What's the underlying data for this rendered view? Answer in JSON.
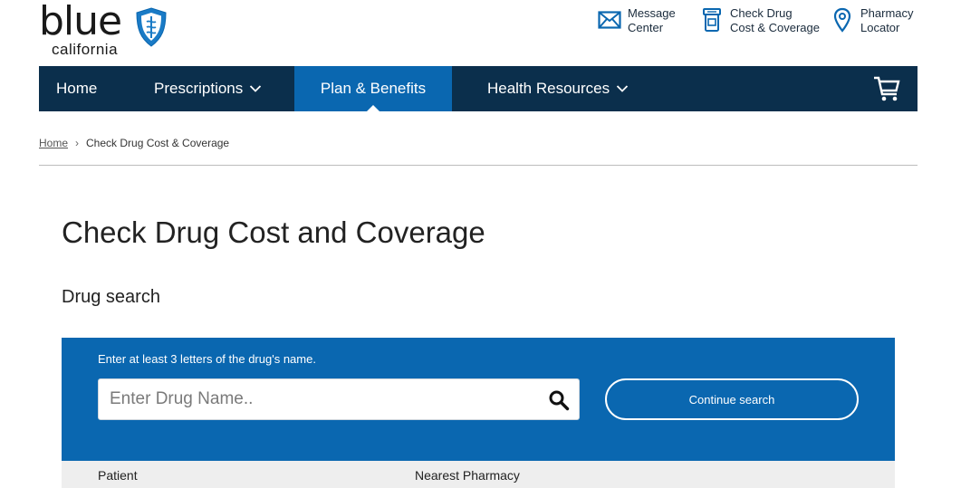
{
  "logo": {
    "word": "blue",
    "sub": "california"
  },
  "utility": [
    {
      "label_line1": "Message",
      "label_line2": "Center",
      "icon": "envelope-icon"
    },
    {
      "label_line1": "Check Drug",
      "label_line2": "Cost & Coverage",
      "icon": "pill-bottle-icon"
    },
    {
      "label_line1": "Pharmacy",
      "label_line2": "Locator",
      "icon": "map-pin-icon"
    }
  ],
  "nav": {
    "home": "Home",
    "prescriptions": "Prescriptions",
    "plan": "Plan & Benefits",
    "health": "Health Resources",
    "cart_icon": "cart-icon"
  },
  "breadcrumb": {
    "home": "Home",
    "current": "Check Drug Cost & Coverage"
  },
  "page": {
    "title": "Check Drug Cost and Coverage",
    "subtitle": "Drug search"
  },
  "search": {
    "hint": "Enter at least 3 letters of the drug's name.",
    "placeholder": "Enter Drug Name..",
    "value": "",
    "continue_label": "Continue search"
  },
  "table": {
    "columns": [
      "Patient",
      "Nearest Pharmacy"
    ]
  },
  "colors": {
    "nav_bg": "#0b2f4c",
    "accent": "#0a67b0",
    "table_head": "#eeeeee"
  }
}
